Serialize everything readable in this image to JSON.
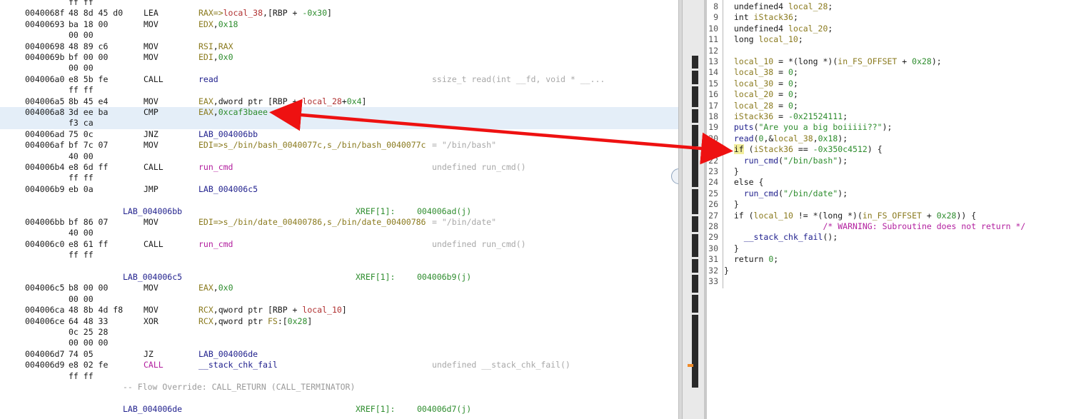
{
  "listing": {
    "rows": [
      {
        "bytes": "ff ff"
      },
      {
        "addr": "0040068f",
        "bytes": "48 8d 45 d0",
        "mnem": "LEA",
        "ops": [
          {
            "t": "RAX=>",
            "c": "olive"
          },
          {
            "t": "local_38",
            "c": "red"
          },
          {
            "t": ",[RBP + ",
            "c": "plain"
          },
          {
            "t": "-0x30",
            "c": "green"
          },
          {
            "t": "]",
            "c": "plain"
          }
        ]
      },
      {
        "addr": "00400693",
        "bytes": "ba 18 00",
        "mnem": "MOV",
        "ops": [
          {
            "t": "EDX",
            "c": "olive"
          },
          {
            "t": ",",
            "c": "plain"
          },
          {
            "t": "0x18",
            "c": "green"
          }
        ]
      },
      {
        "bytes": "00 00"
      },
      {
        "addr": "00400698",
        "bytes": "48 89 c6",
        "mnem": "MOV",
        "ops": [
          {
            "t": "RSI",
            "c": "olive"
          },
          {
            "t": ",",
            "c": "plain"
          },
          {
            "t": "RAX",
            "c": "olive"
          }
        ]
      },
      {
        "addr": "0040069b",
        "bytes": "bf 00 00",
        "mnem": "MOV",
        "ops": [
          {
            "t": "EDI",
            "c": "olive"
          },
          {
            "t": ",",
            "c": "plain"
          },
          {
            "t": "0x0",
            "c": "green"
          }
        ]
      },
      {
        "bytes": "00 00"
      },
      {
        "addr": "004006a0",
        "bytes": "e8 5b fe",
        "mnem": "CALL",
        "ops": [
          {
            "t": "read",
            "c": "blue"
          }
        ],
        "cmt": "ssize_t read(int __fd, void * __..."
      },
      {
        "bytes": "ff ff"
      },
      {
        "addr": "004006a5",
        "bytes": "8b 45 e4",
        "mnem": "MOV",
        "ops": [
          {
            "t": "EAX",
            "c": "olive"
          },
          {
            "t": ",dword ptr [RBP + ",
            "c": "plain"
          },
          {
            "t": "local_28",
            "c": "red"
          },
          {
            "t": "+",
            "c": "plain"
          },
          {
            "t": "0x4",
            "c": "green"
          },
          {
            "t": "]",
            "c": "plain"
          }
        ]
      },
      {
        "addr": "004006a8",
        "bytes": "3d ee ba",
        "mnem": "CMP",
        "hl": true,
        "ops": [
          {
            "t": "EAX",
            "c": "olive"
          },
          {
            "t": ",",
            "c": "plain"
          },
          {
            "t": "0xcaf3baee",
            "c": "green"
          }
        ]
      },
      {
        "bytes": "f3 ca",
        "hl": true
      },
      {
        "addr": "004006ad",
        "bytes": "75 0c",
        "mnem": "JNZ",
        "ops": [
          {
            "t": "LAB_004006bb",
            "c": "blue"
          }
        ]
      },
      {
        "addr": "004006af",
        "bytes": "bf 7c 07",
        "mnem": "MOV",
        "ops": [
          {
            "t": "EDI=>s_/bin/bash_0040077c,s_/bin/bash_0040077c",
            "c": "olive"
          }
        ],
        "cmt": "= \"/bin/bash\""
      },
      {
        "bytes": "40 00"
      },
      {
        "addr": "004006b4",
        "bytes": "e8 6d ff",
        "mnem": "CALL",
        "ops": [
          {
            "t": "run_cmd",
            "c": "mag"
          }
        ],
        "cmt": "undefined run_cmd()"
      },
      {
        "bytes": "ff ff"
      },
      {
        "addr": "004006b9",
        "bytes": "eb 0a",
        "mnem": "JMP",
        "ops": [
          {
            "t": "LAB_004006c5",
            "c": "blue"
          }
        ]
      },
      {},
      {
        "label": "LAB_004006bb",
        "xref": "XREF[1]:",
        "xaddr": "004006ad(j)"
      },
      {
        "addr": "004006bb",
        "bytes": "bf 86 07",
        "mnem": "MOV",
        "ops": [
          {
            "t": "EDI=>s_/bin/date_00400786,s_/bin/date_00400786",
            "c": "olive"
          }
        ],
        "cmt": "= \"/bin/date\""
      },
      {
        "bytes": "40 00"
      },
      {
        "addr": "004006c0",
        "bytes": "e8 61 ff",
        "mnem": "CALL",
        "ops": [
          {
            "t": "run_cmd",
            "c": "mag"
          }
        ],
        "cmt": "undefined run_cmd()"
      },
      {
        "bytes": "ff ff"
      },
      {},
      {
        "label": "LAB_004006c5",
        "xref": "XREF[1]:",
        "xaddr": "004006b9(j)"
      },
      {
        "addr": "004006c5",
        "bytes": "b8 00 00",
        "mnem": "MOV",
        "ops": [
          {
            "t": "EAX",
            "c": "olive"
          },
          {
            "t": ",",
            "c": "plain"
          },
          {
            "t": "0x0",
            "c": "green"
          }
        ]
      },
      {
        "bytes": "00 00"
      },
      {
        "addr": "004006ca",
        "bytes": "48 8b 4d f8",
        "mnem": "MOV",
        "ops": [
          {
            "t": "RCX",
            "c": "olive"
          },
          {
            "t": ",qword ptr [RBP + ",
            "c": "plain"
          },
          {
            "t": "local_10",
            "c": "red"
          },
          {
            "t": "]",
            "c": "plain"
          }
        ]
      },
      {
        "addr": "004006ce",
        "bytes": "64 48 33",
        "mnem": "XOR",
        "ops": [
          {
            "t": "RCX",
            "c": "olive"
          },
          {
            "t": ",qword ptr ",
            "c": "plain"
          },
          {
            "t": "FS",
            "c": "olive"
          },
          {
            "t": ":[",
            "c": "plain"
          },
          {
            "t": "0x28",
            "c": "green"
          },
          {
            "t": "]",
            "c": "plain"
          }
        ]
      },
      {
        "bytes": "0c 25 28"
      },
      {
        "bytes": "00 00 00"
      },
      {
        "addr": "004006d7",
        "bytes": "74 05",
        "mnem": "JZ",
        "ops": [
          {
            "t": "LAB_004006de",
            "c": "blue"
          }
        ]
      },
      {
        "addr": "004006d9",
        "bytes": "e8 02 fe",
        "mnem": "CALL",
        "mnemColor": "mag",
        "ops": [
          {
            "t": "__stack_chk_fail",
            "c": "blue"
          }
        ],
        "cmt": "undefined __stack_chk_fail()"
      },
      {
        "bytes": "ff ff"
      },
      {
        "flow": "-- Flow Override: CALL_RETURN (CALL_TERMINATOR)"
      },
      {},
      {
        "label": "LAB_004006de",
        "xref": "XREF[1]:",
        "xaddr": "004006d7(j)"
      }
    ]
  },
  "decompiler": {
    "lines": [
      {
        "n": "8",
        "tokens": [
          {
            "t": "  undefined4 ",
            "c": "kw"
          },
          {
            "t": "local_28",
            "c": "var"
          },
          {
            "t": ";",
            "c": "kw"
          }
        ]
      },
      {
        "n": "9",
        "tokens": [
          {
            "t": "  int ",
            "c": "kw"
          },
          {
            "t": "iStack36",
            "c": "var"
          },
          {
            "t": ";",
            "c": "kw"
          }
        ]
      },
      {
        "n": "10",
        "tokens": [
          {
            "t": "  undefined4 ",
            "c": "kw"
          },
          {
            "t": "local_20",
            "c": "var"
          },
          {
            "t": ";",
            "c": "kw"
          }
        ]
      },
      {
        "n": "11",
        "tokens": [
          {
            "t": "  long ",
            "c": "kw"
          },
          {
            "t": "local_10",
            "c": "var"
          },
          {
            "t": ";",
            "c": "kw"
          }
        ]
      },
      {
        "n": "12",
        "tokens": []
      },
      {
        "n": "13",
        "tokens": [
          {
            "t": "  local_10",
            "c": "var"
          },
          {
            "t": " = *(long *)(",
            "c": "kw"
          },
          {
            "t": "in_FS_OFFSET",
            "c": "var"
          },
          {
            "t": " + ",
            "c": "kw"
          },
          {
            "t": "0x28",
            "c": "num"
          },
          {
            "t": ");",
            "c": "kw"
          }
        ]
      },
      {
        "n": "14",
        "tokens": [
          {
            "t": "  local_38",
            "c": "var"
          },
          {
            "t": " = ",
            "c": "kw"
          },
          {
            "t": "0",
            "c": "num"
          },
          {
            "t": ";",
            "c": "kw"
          }
        ]
      },
      {
        "n": "15",
        "tokens": [
          {
            "t": "  local_30",
            "c": "var"
          },
          {
            "t": " = ",
            "c": "kw"
          },
          {
            "t": "0",
            "c": "num"
          },
          {
            "t": ";",
            "c": "kw"
          }
        ]
      },
      {
        "n": "16",
        "tokens": [
          {
            "t": "  local_20",
            "c": "var"
          },
          {
            "t": " = ",
            "c": "kw"
          },
          {
            "t": "0",
            "c": "num"
          },
          {
            "t": ";",
            "c": "kw"
          }
        ]
      },
      {
        "n": "17",
        "tokens": [
          {
            "t": "  local_28",
            "c": "var"
          },
          {
            "t": " = ",
            "c": "kw"
          },
          {
            "t": "0",
            "c": "num"
          },
          {
            "t": ";",
            "c": "kw"
          }
        ]
      },
      {
        "n": "18",
        "tokens": [
          {
            "t": "  iStack36",
            "c": "var"
          },
          {
            "t": " = ",
            "c": "kw"
          },
          {
            "t": "-0x21524111",
            "c": "num"
          },
          {
            "t": ";",
            "c": "kw"
          }
        ]
      },
      {
        "n": "19",
        "tokens": [
          {
            "t": "  ",
            "c": "kw"
          },
          {
            "t": "puts",
            "c": "fn"
          },
          {
            "t": "(",
            "c": "kw"
          },
          {
            "t": "\"Are you a big boiiiii??\"",
            "c": "str"
          },
          {
            "t": ");",
            "c": "kw"
          }
        ]
      },
      {
        "n": "20",
        "tokens": [
          {
            "t": "  ",
            "c": "kw"
          },
          {
            "t": "read",
            "c": "fn"
          },
          {
            "t": "(",
            "c": "kw"
          },
          {
            "t": "0",
            "c": "num"
          },
          {
            "t": ",&",
            "c": "kw"
          },
          {
            "t": "local_38",
            "c": "var"
          },
          {
            "t": ",",
            "c": "kw"
          },
          {
            "t": "0x18",
            "c": "num"
          },
          {
            "t": ");",
            "c": "kw"
          }
        ]
      },
      {
        "n": "21",
        "tokens": [
          {
            "t": "  ",
            "c": "kw"
          },
          {
            "t": "if",
            "c": "ifhl"
          },
          {
            "t": " (",
            "c": "kw"
          },
          {
            "t": "iStack36",
            "c": "var"
          },
          {
            "t": " == ",
            "c": "kw"
          },
          {
            "t": "-0x350c4512",
            "c": "num"
          },
          {
            "t": ") {",
            "c": "kw"
          }
        ]
      },
      {
        "n": "22",
        "tokens": [
          {
            "t": "    ",
            "c": "kw"
          },
          {
            "t": "run_cmd",
            "c": "fn"
          },
          {
            "t": "(",
            "c": "kw"
          },
          {
            "t": "\"/bin/bash\"",
            "c": "str"
          },
          {
            "t": ");",
            "c": "kw"
          }
        ]
      },
      {
        "n": "23",
        "tokens": [
          {
            "t": "  }",
            "c": "kw"
          }
        ]
      },
      {
        "n": "24",
        "tokens": [
          {
            "t": "  else {",
            "c": "kw"
          }
        ]
      },
      {
        "n": "25",
        "tokens": [
          {
            "t": "    ",
            "c": "kw"
          },
          {
            "t": "run_cmd",
            "c": "fn"
          },
          {
            "t": "(",
            "c": "kw"
          },
          {
            "t": "\"/bin/date\"",
            "c": "str"
          },
          {
            "t": ");",
            "c": "kw"
          }
        ]
      },
      {
        "n": "26",
        "tokens": [
          {
            "t": "  }",
            "c": "kw"
          }
        ]
      },
      {
        "n": "27",
        "tokens": [
          {
            "t": "  if (",
            "c": "kw"
          },
          {
            "t": "local_10",
            "c": "var"
          },
          {
            "t": " != *(long *)(",
            "c": "kw"
          },
          {
            "t": "in_FS_OFFSET",
            "c": "var"
          },
          {
            "t": " + ",
            "c": "kw"
          },
          {
            "t": "0x28",
            "c": "num"
          },
          {
            "t": ")) {",
            "c": "kw"
          }
        ]
      },
      {
        "n": "28",
        "tokens": [
          {
            "t": "                    ",
            "c": "kw"
          },
          {
            "t": "/* WARNING: Subroutine does not return */",
            "c": "cmt"
          }
        ]
      },
      {
        "n": "29",
        "tokens": [
          {
            "t": "    ",
            "c": "kw"
          },
          {
            "t": "__stack_chk_fail",
            "c": "fn"
          },
          {
            "t": "();",
            "c": "kw"
          }
        ]
      },
      {
        "n": "30",
        "tokens": [
          {
            "t": "  }",
            "c": "kw"
          }
        ]
      },
      {
        "n": "31",
        "tokens": [
          {
            "t": "  return ",
            "c": "kw"
          },
          {
            "t": "0",
            "c": "num"
          },
          {
            "t": ";",
            "c": "kw"
          }
        ]
      },
      {
        "n": "32",
        "tokens": [
          {
            "t": "}",
            "c": "kw"
          }
        ]
      },
      {
        "n": "33",
        "tokens": []
      }
    ]
  },
  "annotation": {
    "arrow_color": "#ee1111"
  },
  "colors": {
    "highlight_row": "#e4eef8",
    "if_highlight": "#f2ee9c",
    "overview_marker": "#f08a28"
  }
}
